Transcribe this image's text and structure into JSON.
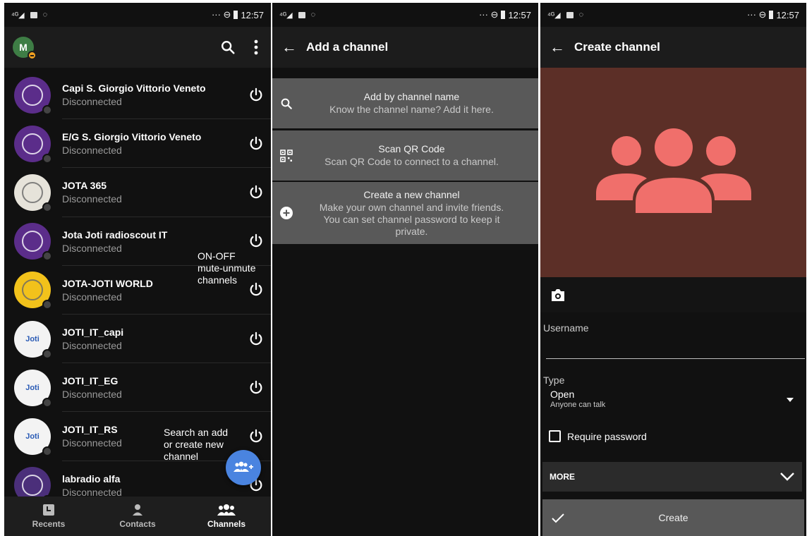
{
  "status_bar": {
    "time": "12:57",
    "left_glyphs": "⁴ᴳ◢",
    "right_glyphs": "··· ⊖"
  },
  "screen_channels": {
    "avatar_initial": "M",
    "channels": [
      {
        "name": "Capi S. Giorgio Vittorio Veneto",
        "status": "Disconnected",
        "avatar_color": "#5b2d8a",
        "avatar_text": ""
      },
      {
        "name": "E/G S. Giorgio Vittorio Veneto",
        "status": "Disconnected",
        "avatar_color": "#5b2d8a",
        "avatar_text": ""
      },
      {
        "name": "JOTA 365",
        "status": "Disconnected",
        "avatar_color": "#e6e3da",
        "avatar_text": ""
      },
      {
        "name": "Jota Joti radioscout IT",
        "status": "Disconnected",
        "avatar_color": "#5b2d8a",
        "avatar_text": ""
      },
      {
        "name": "JOTA-JOTI WORLD",
        "status": "Disconnected",
        "avatar_color": "#f2c21b",
        "avatar_text": ""
      },
      {
        "name": "JOTI_IT_capi",
        "status": "Disconnected",
        "avatar_color": "#f3f3f3",
        "avatar_text": "Joti"
      },
      {
        "name": "JOTI_IT_EG",
        "status": "Disconnected",
        "avatar_color": "#f3f3f3",
        "avatar_text": "Joti"
      },
      {
        "name": "JOTI_IT_RS",
        "status": "Disconnected",
        "avatar_color": "#f3f3f3",
        "avatar_text": "Joti"
      },
      {
        "name": "labradio alfa",
        "status": "Disconnected",
        "avatar_color": "#4b2f7a",
        "avatar_text": ""
      }
    ],
    "note_power": "ON-OFF\nmute-unmute\nchannels",
    "note_fab": "Search an add\nor create new\nchannel",
    "nav": {
      "recents": "Recents",
      "contacts": "Contacts",
      "channels": "Channels"
    }
  },
  "screen_add": {
    "title": "Add a channel",
    "options": [
      {
        "title": "Add by channel name",
        "desc": "Know the channel name? Add it here."
      },
      {
        "title": "Scan QR Code",
        "desc": "Scan QR Code to connect to a channel."
      },
      {
        "title": "Create a new channel",
        "desc": "Make your own channel and invite friends.\nYou can set channel password to keep it\nprivate."
      }
    ]
  },
  "screen_create": {
    "title": "Create channel",
    "username_label": "Username",
    "type_label": "Type",
    "type_value": "Open",
    "type_desc": "Anyone can talk",
    "require_password": "Require password",
    "more_label": "MORE",
    "create_label": "Create"
  },
  "colors": {
    "accent_blue": "#4a84e0",
    "group_icon": "#f06f6b",
    "cover_bg": "#5c2f27"
  }
}
